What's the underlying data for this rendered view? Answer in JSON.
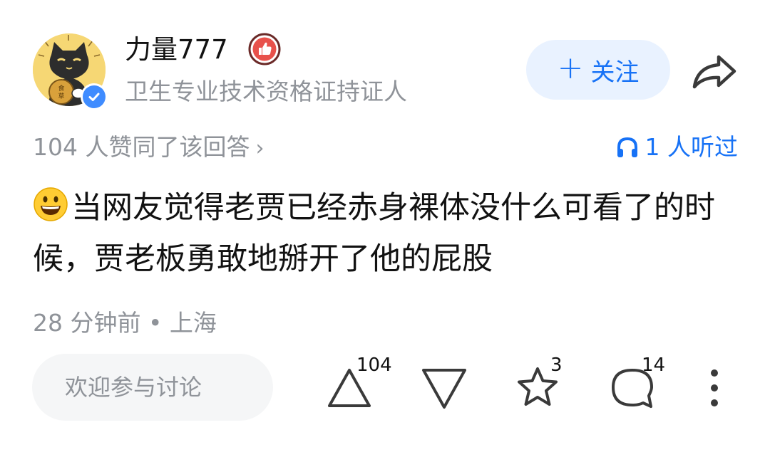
{
  "author": {
    "name": "力量777",
    "title": "卫生专业技术资格证持证人",
    "verified": true,
    "avatar_glyph": "食草"
  },
  "follow_button": {
    "label": "关注"
  },
  "stats": {
    "votes_summary": "104 人赞同了该回答",
    "listened": "1 人听过"
  },
  "content": {
    "text": "当网友觉得老贾已经赤身裸体没什么可看了的时候，贾老板勇敢地掰开了他的屁股"
  },
  "meta": {
    "time_location": "28 分钟前 • 上海"
  },
  "actions": {
    "comment_placeholder": "欢迎参与讨论",
    "upvote_count": "104",
    "favorite_count": "3",
    "comment_count": "14"
  },
  "colors": {
    "accent_blue": "#1772f6",
    "follow_bg": "#e9f2ff",
    "secondary_text": "#8f9399",
    "badge_red": "#e8514b",
    "verified_blue": "#3f8cff"
  },
  "icons": {
    "share": "share-arrow-icon",
    "headphones": "headphones-icon",
    "upvote": "triangle-up-icon",
    "downvote": "triangle-down-icon",
    "favorite": "star-icon",
    "comment": "comment-bubble-icon",
    "more": "more-vertical-icon"
  }
}
